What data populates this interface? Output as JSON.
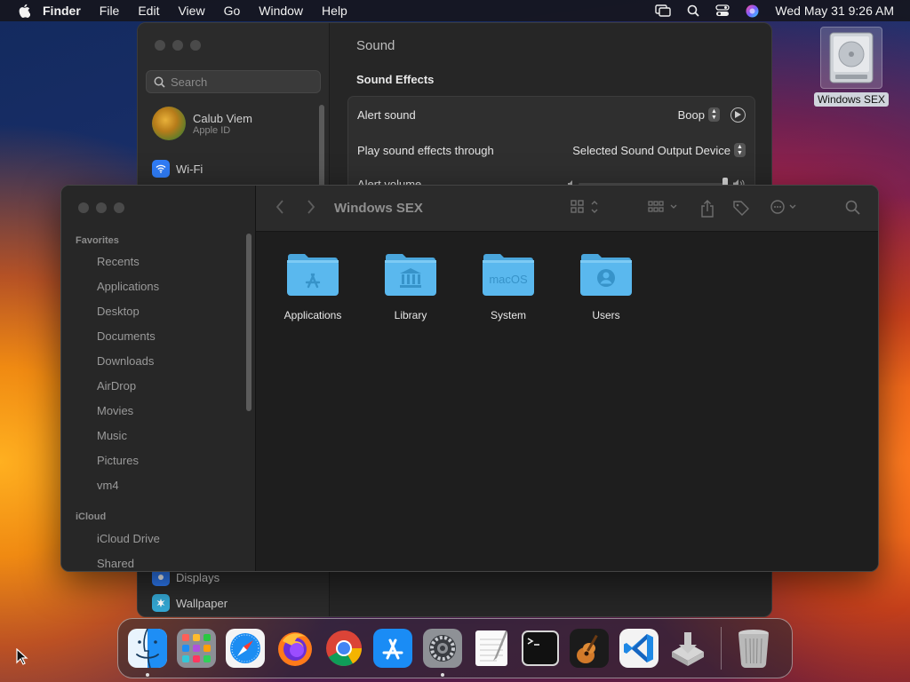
{
  "menubar": {
    "app_name": "Finder",
    "items": [
      "File",
      "Edit",
      "View",
      "Go",
      "Window",
      "Help"
    ],
    "clock": "Wed May 31  9:26 AM",
    "status_icons": [
      "screen-mirroring-icon",
      "spotlight-search-icon",
      "control-center-icon",
      "siri-icon"
    ]
  },
  "desktop": {
    "disk_label": "Windows SEX"
  },
  "settings": {
    "title": "Sound",
    "search_placeholder": "Search",
    "account": {
      "name": "Calub Viem",
      "subtitle": "Apple ID"
    },
    "sidebar_items": [
      {
        "label": "Wi-Fi",
        "icon": "wifi-icon",
        "color": "#2f7cf6"
      },
      {
        "label": "Displays",
        "icon": "displays-icon",
        "color": "#2f7cf6"
      },
      {
        "label": "Wallpaper",
        "icon": "wallpaper-icon",
        "color": "#35a9d6"
      }
    ],
    "section_title": "Sound Effects",
    "rows": {
      "alert_sound": {
        "label": "Alert sound",
        "value": "Boop"
      },
      "play_through": {
        "label": "Play sound effects through",
        "value": "Selected Sound Output Device"
      },
      "alert_volume": {
        "label": "Alert volume",
        "level": 1.0
      }
    }
  },
  "finder": {
    "title": "Windows SEX",
    "sidebar": {
      "favorites_header": "Favorites",
      "favorites": [
        "Recents",
        "Applications",
        "Desktop",
        "Documents",
        "Downloads",
        "AirDrop",
        "Movies",
        "Music",
        "Pictures",
        "vm4"
      ],
      "icloud_header": "iCloud",
      "icloud": [
        "iCloud Drive",
        "Shared"
      ]
    },
    "items": [
      {
        "label": "Applications",
        "badge": "app-store-a"
      },
      {
        "label": "Library",
        "badge": "library-columns"
      },
      {
        "label": "System",
        "badge": "macOS"
      },
      {
        "label": "Users",
        "badge": "user"
      }
    ]
  },
  "dock": {
    "apps": [
      {
        "name": "Finder",
        "icon": "finder-icon",
        "running": true
      },
      {
        "name": "Launchpad",
        "icon": "launchpad-icon",
        "running": false
      },
      {
        "name": "Safari",
        "icon": "safari-icon",
        "running": false
      },
      {
        "name": "Firefox",
        "icon": "firefox-icon",
        "running": false
      },
      {
        "name": "Chrome",
        "icon": "chrome-icon",
        "running": false
      },
      {
        "name": "App Store",
        "icon": "app-store-icon",
        "running": false
      },
      {
        "name": "System Settings",
        "icon": "system-settings-icon",
        "running": true
      },
      {
        "name": "TextEdit",
        "icon": "textedit-icon",
        "running": false
      },
      {
        "name": "Terminal",
        "icon": "terminal-icon",
        "running": false
      },
      {
        "name": "GarageBand",
        "icon": "garageband-icon",
        "running": false
      },
      {
        "name": "Visual Studio Code",
        "icon": "vscode-icon",
        "running": false
      },
      {
        "name": "Installer",
        "icon": "installer-icon",
        "running": false
      },
      {
        "name": "Trash",
        "icon": "trash-icon",
        "running": false
      }
    ]
  },
  "colors": {
    "accent": "#2f7cf6",
    "folder_blue": "#5ab8ee"
  }
}
